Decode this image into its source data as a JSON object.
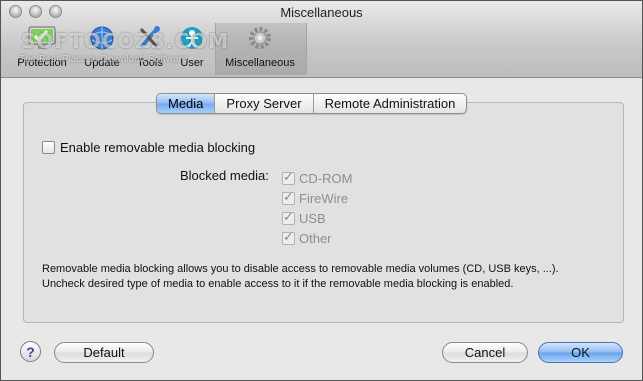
{
  "window": {
    "title": "Miscellaneous"
  },
  "toolbar": {
    "items": [
      {
        "label": "Protection",
        "icon": "monitor-check-icon"
      },
      {
        "label": "Update",
        "icon": "globe-update-icon"
      },
      {
        "label": "Tools",
        "icon": "tools-icon"
      },
      {
        "label": "User",
        "icon": "user-icon"
      },
      {
        "label": "Miscellaneous",
        "icon": "gear-icon"
      }
    ],
    "watermark": "SOFTOCOZ3.COM",
    "watermark_sub": "The Best Place to Download Software"
  },
  "tabs": [
    {
      "label": "Media",
      "active": true
    },
    {
      "label": "Proxy Server",
      "active": false
    },
    {
      "label": "Remote Administration",
      "active": false
    }
  ],
  "media": {
    "enable_label": "Enable removable media blocking",
    "enable_checked": false,
    "blocked_label": "Blocked media:",
    "items": [
      {
        "label": "CD-ROM",
        "checked": true
      },
      {
        "label": "FireWire",
        "checked": true
      },
      {
        "label": "USB",
        "checked": true
      },
      {
        "label": "Other",
        "checked": true
      }
    ],
    "description_line1": "Removable media blocking allows you to disable access to removable media volumes (CD, USB keys, ...).",
    "description_line2": "Uncheck desired type of media to enable access to it if the removable media blocking is enabled."
  },
  "buttons": {
    "help": "?",
    "default": "Default",
    "cancel": "Cancel",
    "ok": "OK"
  },
  "colors": {
    "accent": "#74a9ee"
  }
}
